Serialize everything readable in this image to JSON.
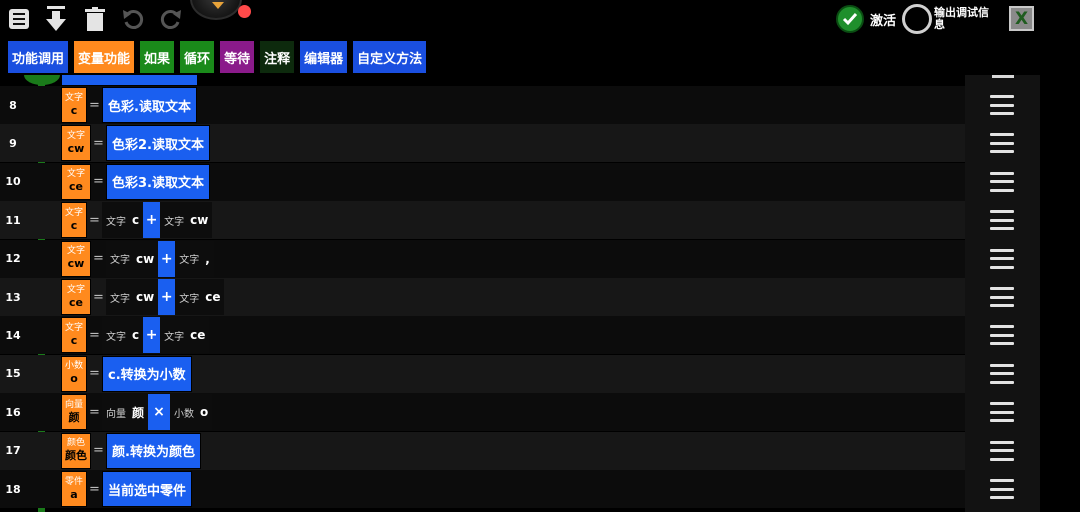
{
  "toolbar": {
    "icons": [
      "list-icon",
      "download-icon",
      "trash-icon",
      "undo-icon",
      "redo-icon",
      "knob-icon",
      "record-dot-icon"
    ],
    "activate_label": "激活",
    "debug_label": "输出调试信息",
    "close_label": "X",
    "colors": {
      "activate": "#1f8f2c",
      "record": "#ff4a4a",
      "knob_arrow": "#e8a33a"
    }
  },
  "tabs": [
    {
      "label": "功能调用",
      "color": "#1a4fe0"
    },
    {
      "label": "变量功能",
      "color": "#ff8a1e"
    },
    {
      "label": "如果",
      "color": "#1a8a1a"
    },
    {
      "label": "循环",
      "color": "#1a8a1a"
    },
    {
      "label": "等待",
      "color": "#8a1a8a"
    },
    {
      "label": "注释",
      "color": "#0d2a0d"
    },
    {
      "label": "编辑器",
      "color": "#1a4fe0"
    },
    {
      "label": "自定义方法",
      "color": "#1a4fe0"
    }
  ],
  "colors": {
    "block_blue": "#1a5ff0",
    "var_orange": "#ff8a1e",
    "track_green": "#1a7a1a"
  },
  "rows": [
    {
      "line": "8",
      "var_type": "文字",
      "var_name": "c",
      "method": "色彩.读取文本"
    },
    {
      "line": "9",
      "var_type": "文字",
      "var_name": "cw",
      "method": "色彩2.读取文本"
    },
    {
      "line": "10",
      "var_type": "文字",
      "var_name": "ce",
      "method": "色彩3.读取文本"
    },
    {
      "line": "11",
      "var_type": "文字",
      "var_name": "c",
      "left_type": "文字",
      "left_name": "c",
      "operator": "+",
      "right_type": "文字",
      "right_name": "cw"
    },
    {
      "line": "12",
      "var_type": "文字",
      "var_name": "cw",
      "left_type": "文字",
      "left_name": "cw",
      "operator": "+",
      "right_type": "文字",
      "right_name": ","
    },
    {
      "line": "13",
      "var_type": "文字",
      "var_name": "ce",
      "left_type": "文字",
      "left_name": "cw",
      "operator": "+",
      "right_type": "文字",
      "right_name": "ce"
    },
    {
      "line": "14",
      "var_type": "文字",
      "var_name": "c",
      "left_type": "文字",
      "left_name": "c",
      "operator": "+",
      "right_type": "文字",
      "right_name": "ce"
    },
    {
      "line": "15",
      "var_type": "小数",
      "var_name": "o",
      "method": "c.转换为小数"
    },
    {
      "line": "16",
      "var_type": "向量",
      "var_name": "颜",
      "left_type": "向量",
      "left_name": "颜",
      "operator": "×",
      "right_type": "小数",
      "right_name": "o"
    },
    {
      "line": "17",
      "var_type": "颜色",
      "var_name": "颜色",
      "method": "颜.转换为颜色"
    },
    {
      "line": "18",
      "var_type": "零件",
      "var_name": "a",
      "method": "当前选中零件"
    }
  ],
  "row_menu_icon": "hamburger-menu-icon"
}
